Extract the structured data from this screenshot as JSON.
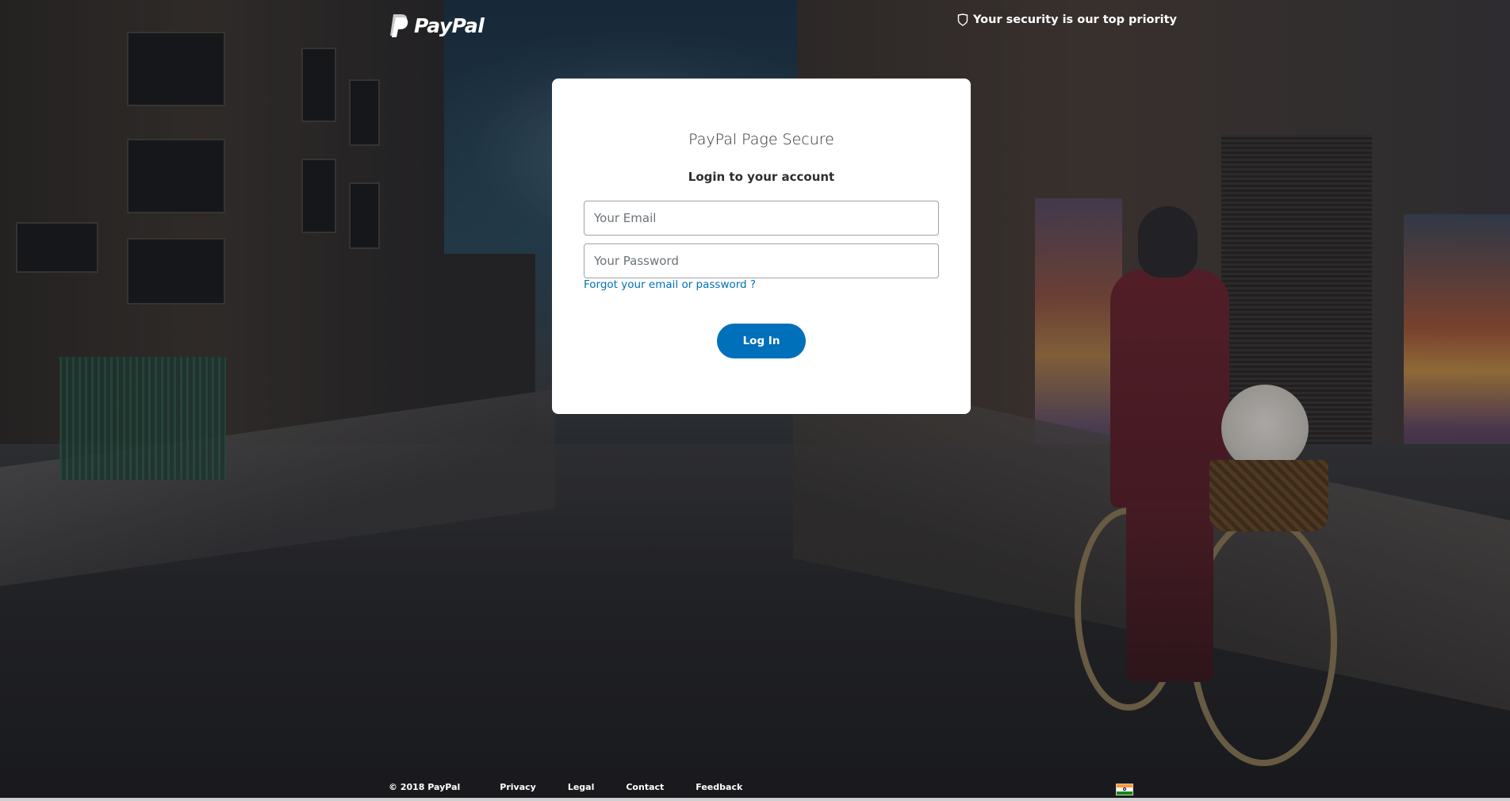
{
  "header": {
    "brand": "PayPal",
    "security_text": "Your security is our top priority"
  },
  "login": {
    "title": "PayPal Page Secure",
    "subtitle": "Login to your account",
    "email_placeholder": "Your Email",
    "password_placeholder": "Your Password",
    "email_value": "",
    "password_value": "",
    "forgot_link": "Forgot your email or password ?",
    "login_button": "Log In"
  },
  "footer": {
    "copyright": "© 2018 PayPal",
    "links": [
      "Privacy",
      "Legal",
      "Contact",
      "Feedback"
    ],
    "country_flag": "india-flag-icon"
  },
  "colors": {
    "brand_blue": "#0070ba",
    "card_bg": "#ffffff",
    "text_dark": "#2c2e2f",
    "input_border": "#9da3a6"
  },
  "icons": {
    "logo": "paypal-logo-icon",
    "security": "shield-icon"
  }
}
